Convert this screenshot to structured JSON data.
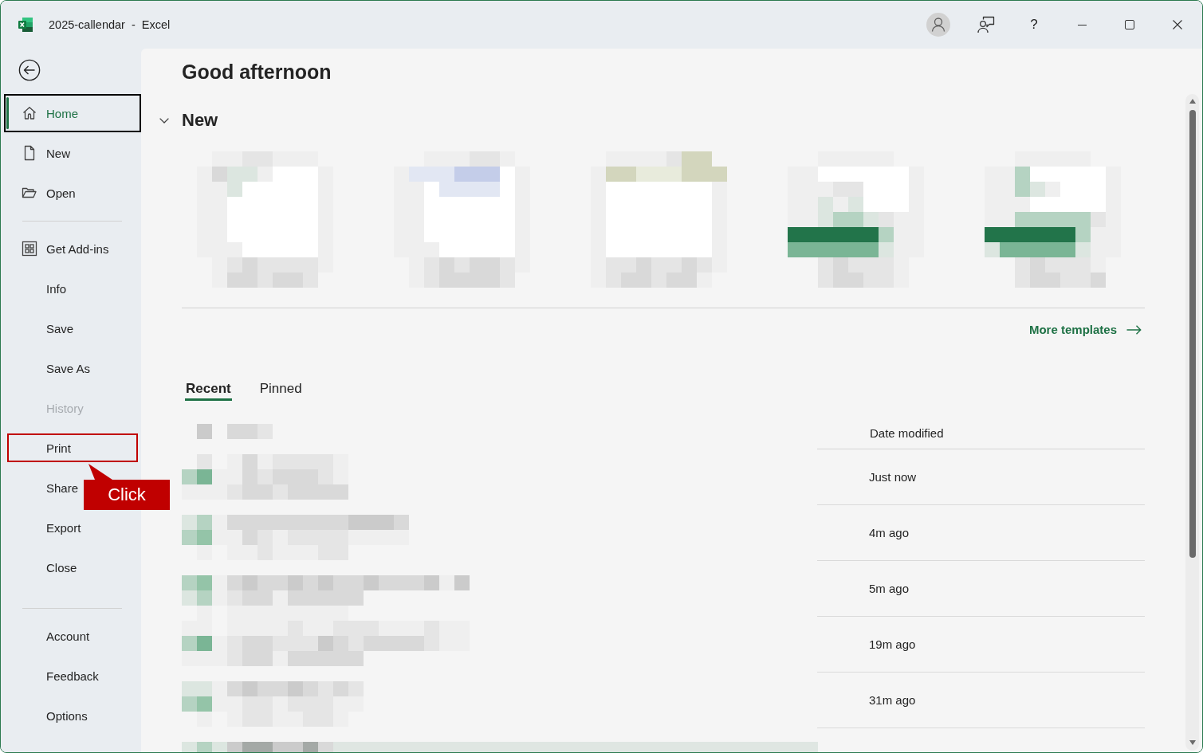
{
  "window": {
    "title": "2025-callendar  -  Excel",
    "help_label": "?"
  },
  "sidebar": {
    "sections": [
      {
        "items": [
          {
            "label": "Home",
            "selected": true,
            "disabled": false,
            "highlighted": false
          },
          {
            "label": "New",
            "selected": false,
            "disabled": false,
            "highlighted": false
          },
          {
            "label": "Open",
            "selected": false,
            "disabled": false,
            "highlighted": false
          }
        ]
      },
      {
        "items": [
          {
            "label": "Get Add-ins",
            "selected": false,
            "disabled": false,
            "highlighted": false
          },
          {
            "label": "Info",
            "selected": false,
            "disabled": false,
            "highlighted": false
          },
          {
            "label": "Save",
            "selected": false,
            "disabled": false,
            "highlighted": false
          },
          {
            "label": "Save As",
            "selected": false,
            "disabled": false,
            "highlighted": false
          },
          {
            "label": "History",
            "selected": false,
            "disabled": true,
            "highlighted": false
          },
          {
            "label": "Print",
            "selected": false,
            "disabled": false,
            "highlighted": true
          },
          {
            "label": "Share",
            "selected": false,
            "disabled": false,
            "highlighted": false
          },
          {
            "label": "Export",
            "selected": false,
            "disabled": false,
            "highlighted": false
          },
          {
            "label": "Close",
            "selected": false,
            "disabled": false,
            "highlighted": false
          }
        ]
      },
      {
        "items": [
          {
            "label": "Account",
            "selected": false,
            "disabled": false,
            "highlighted": false
          },
          {
            "label": "Feedback",
            "selected": false,
            "disabled": false,
            "highlighted": false
          },
          {
            "label": "Options",
            "selected": false,
            "disabled": false,
            "highlighted": false
          }
        ]
      }
    ]
  },
  "callout": {
    "text": "Click"
  },
  "main": {
    "greeting": "Good afternoon",
    "new_section": {
      "title": "New",
      "expanded": true,
      "link": "More templates"
    },
    "tabs": [
      {
        "label": "Recent",
        "selected": true
      },
      {
        "label": "Pinned",
        "selected": false
      }
    ],
    "files": {
      "date_header": "Date modified",
      "rows": [
        {
          "modified": "Just now"
        },
        {
          "modified": "4m ago"
        },
        {
          "modified": "5m ago"
        },
        {
          "modified": "19m ago"
        },
        {
          "modified": "31m ago"
        }
      ]
    }
  }
}
